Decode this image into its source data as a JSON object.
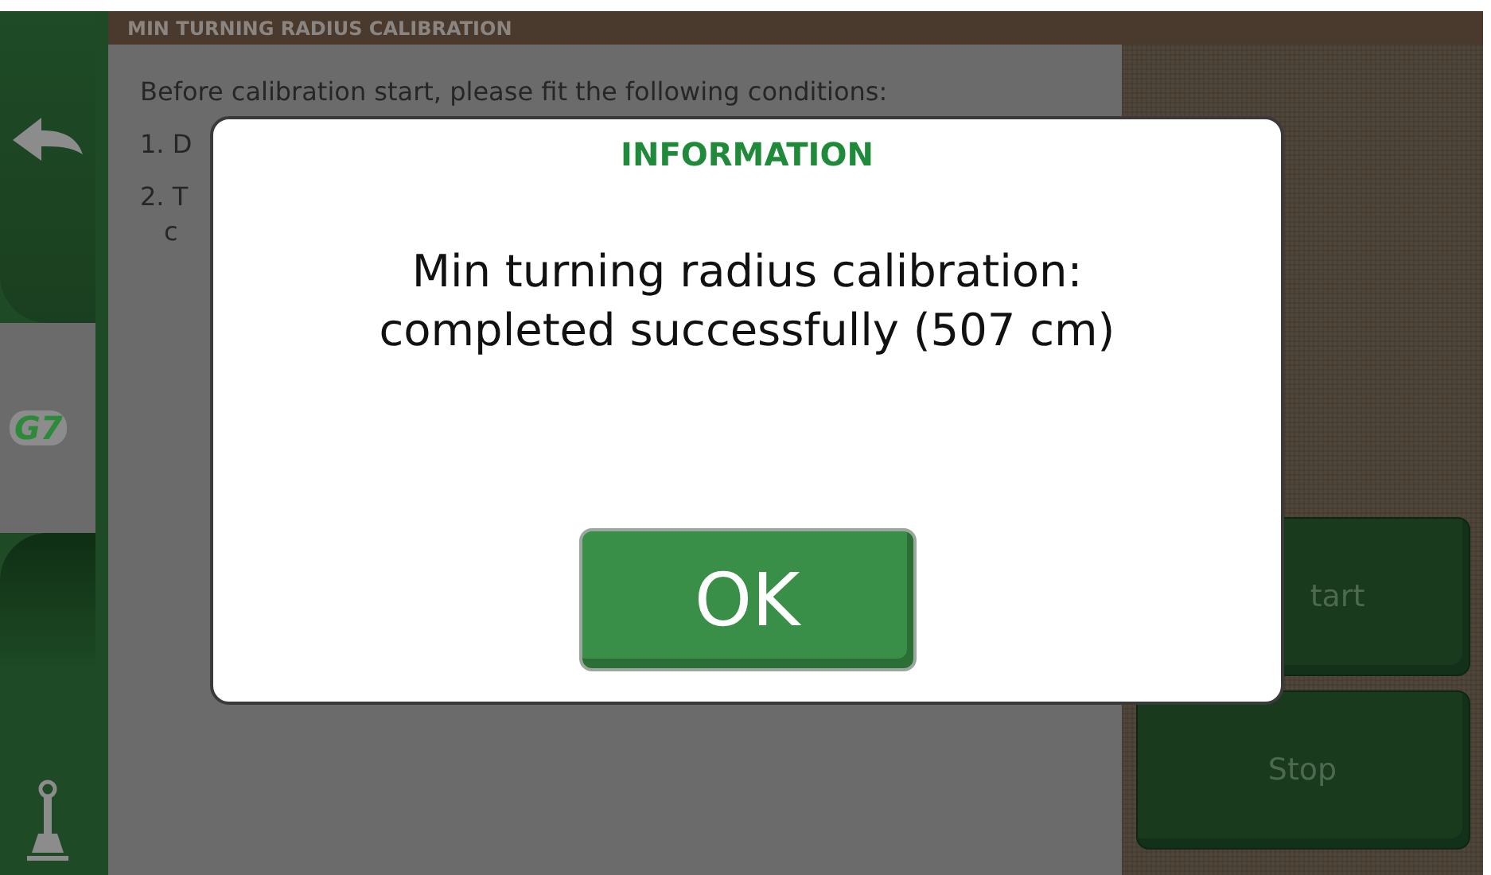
{
  "sidebar": {
    "logo": "G7"
  },
  "header": {
    "title": "MIN TURNING RADIUS CALIBRATION"
  },
  "content": {
    "intro": "Before calibration start, please fit the following conditions:",
    "steps": [
      {
        "lines": [
          "1. D"
        ]
      },
      {
        "lines": [
          "2. T",
          "c"
        ]
      }
    ]
  },
  "actions": [
    "tart",
    "Stop"
  ],
  "dialog": {
    "title": "INFORMATION",
    "message_lines": [
      "Min turning radius calibration:",
      "completed successfully (507 cm)"
    ],
    "button": "OK"
  }
}
